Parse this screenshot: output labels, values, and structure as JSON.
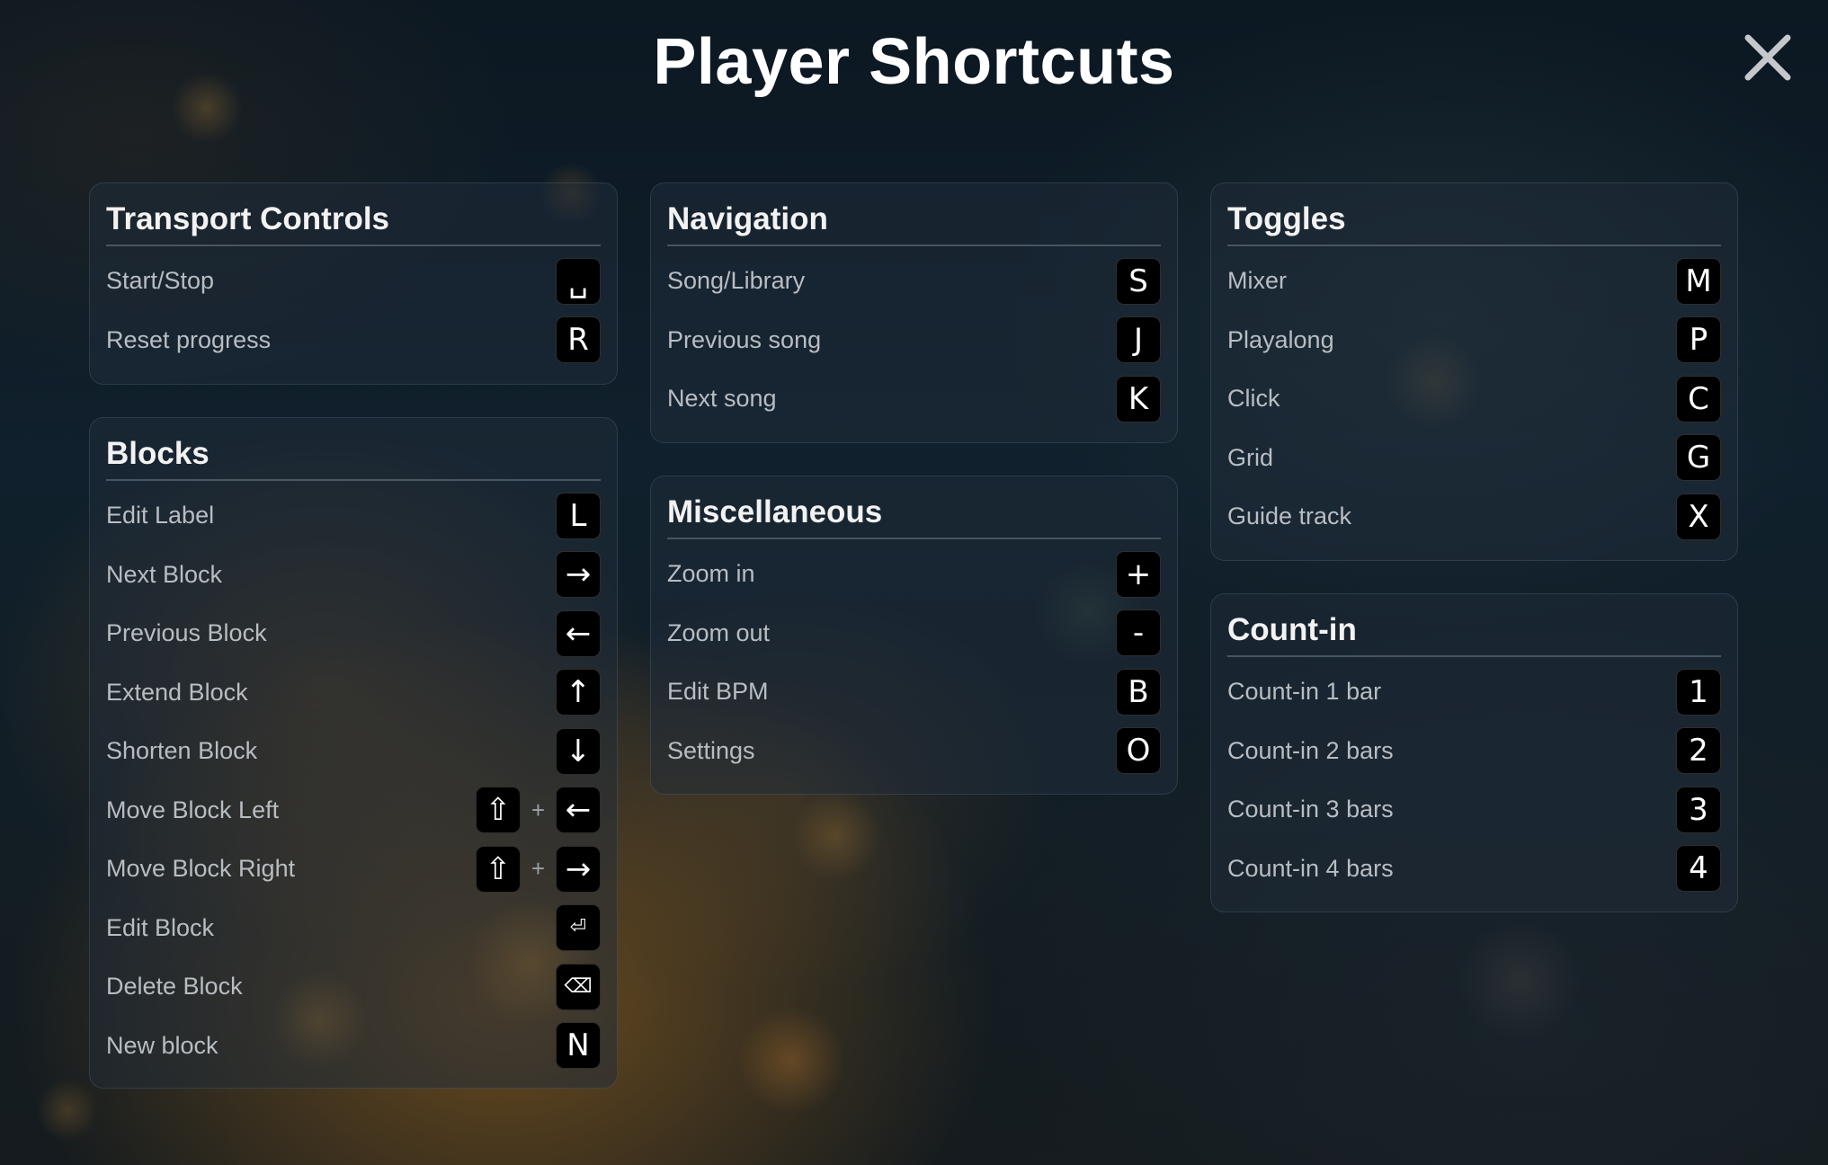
{
  "title": "Player Shortcuts",
  "close_icon": "close-icon",
  "sections": {
    "transport": {
      "title": "Transport Controls",
      "rows": [
        {
          "label": "Start/Stop",
          "key": "␣"
        },
        {
          "label": "Reset progress",
          "key": "R"
        }
      ]
    },
    "blocks": {
      "title": "Blocks",
      "rows": [
        {
          "label": "Edit Label",
          "key": "L"
        },
        {
          "label": "Next Block",
          "key": "→"
        },
        {
          "label": "Previous Block",
          "key": "←"
        },
        {
          "label": "Extend Block",
          "key": "↑"
        },
        {
          "label": "Shorten Block",
          "key": "↓"
        },
        {
          "label": "Move Block Left",
          "modifier": "⇧",
          "plus": "+",
          "key": "←"
        },
        {
          "label": "Move Block Right",
          "modifier": "⇧",
          "plus": "+",
          "key": "→"
        },
        {
          "label": "Edit Block",
          "key": "⏎"
        },
        {
          "label": "Delete Block",
          "key": "⌫"
        },
        {
          "label": "New block",
          "key": "N"
        }
      ]
    },
    "navigation": {
      "title": "Navigation",
      "rows": [
        {
          "label": "Song/Library",
          "key": "S"
        },
        {
          "label": "Previous song",
          "key": "J"
        },
        {
          "label": "Next song",
          "key": "K"
        }
      ]
    },
    "misc": {
      "title": "Miscellaneous",
      "rows": [
        {
          "label": "Zoom in",
          "key": "+"
        },
        {
          "label": "Zoom out",
          "key": "-"
        },
        {
          "label": "Edit BPM",
          "key": "B"
        },
        {
          "label": "Settings",
          "key": "O"
        }
      ]
    },
    "toggles": {
      "title": "Toggles",
      "rows": [
        {
          "label": "Mixer",
          "key": "M"
        },
        {
          "label": "Playalong",
          "key": "P"
        },
        {
          "label": "Click",
          "key": "C"
        },
        {
          "label": "Grid",
          "key": "G"
        },
        {
          "label": "Guide track",
          "key": "X"
        }
      ]
    },
    "countin": {
      "title": "Count-in",
      "rows": [
        {
          "label": "Count-in 1 bar",
          "key": "1"
        },
        {
          "label": "Count-in 2 bars",
          "key": "2"
        },
        {
          "label": "Count-in 3 bars",
          "key": "3"
        },
        {
          "label": "Count-in 4 bars",
          "key": "4"
        }
      ]
    }
  }
}
